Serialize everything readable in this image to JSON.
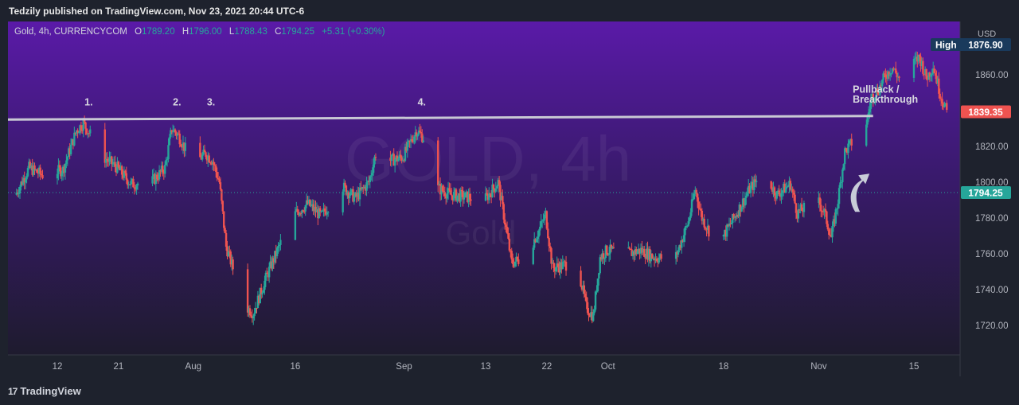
{
  "header": {
    "published": "Tedzily published on TradingView.com, Nov 23, 2021 20:44 UTC-6"
  },
  "footer": {
    "brand": "TradingView",
    "logo_glyph": "17"
  },
  "legend": {
    "symbol": "Gold, 4h, CURRENCYCOM",
    "open_label": "O",
    "open": "1789.20",
    "high_label": "H",
    "high": "1796.00",
    "low_label": "L",
    "low": "1788.43",
    "close_label": "C",
    "close": "1794.25",
    "change": "+5.31 (+0.30%)"
  },
  "watermark": {
    "title": "GOLD, 4h",
    "subtitle": "Gold"
  },
  "colors": {
    "up": "#26a69a",
    "down": "#ef5350",
    "current_price_badge": "#26a69a",
    "breakout_badge": "#ef5350",
    "high_badge": "#1a3a5c",
    "resistance_line": "#c8c8d4",
    "background_top": "#5a1aa8",
    "background_bottom": "#1e1b2e"
  },
  "annotations": [
    {
      "text": "1.",
      "x": "Jul 16",
      "y": 1843
    },
    {
      "text": "2.",
      "x": "Jul 29",
      "y": 1843
    },
    {
      "text": "3.",
      "x": "Aug 3",
      "y": 1843
    },
    {
      "text": "4.",
      "x": "Sep 3",
      "y": 1843
    },
    {
      "text": "Pullback /",
      "x": "Nov 6",
      "y": 1850
    },
    {
      "text": "Breakthrough",
      "x": "Nov 6",
      "y": 1844.5
    }
  ],
  "chart_data": {
    "type": "candlestick",
    "symbol": "Gold",
    "interval": "4h",
    "y_axis_unit": "USD",
    "ylim": [
      1698,
      1895
    ],
    "y_ticks": [
      1720,
      1740,
      1760,
      1780,
      1800,
      1820,
      1840,
      1860
    ],
    "x_ticks": [
      {
        "label": "12",
        "date": "Jul 12"
      },
      {
        "label": "21",
        "date": "Jul 21"
      },
      {
        "label": "Aug",
        "date": "Aug 1"
      },
      {
        "label": "16",
        "date": "Aug 16"
      },
      {
        "label": "Sep",
        "date": "Sep 1"
      },
      {
        "label": "13",
        "date": "Sep 13"
      },
      {
        "label": "22",
        "date": "Sep 22"
      },
      {
        "label": "Oct",
        "date": "Oct 1"
      },
      {
        "label": "18",
        "date": "Oct 18"
      },
      {
        "label": "Nov",
        "date": "Nov 1"
      },
      {
        "label": "15",
        "date": "Nov 15"
      }
    ],
    "price_path": [
      {
        "date": "Jul 6",
        "price": 1793
      },
      {
        "date": "Jul 8",
        "price": 1808
      },
      {
        "date": "Jul 10",
        "price": 1804
      },
      {
        "date": "Jul 13",
        "price": 1807
      },
      {
        "date": "Jul 15",
        "price": 1829
      },
      {
        "date": "Jul 16",
        "price": 1833
      },
      {
        "date": "Jul 19",
        "price": 1814
      },
      {
        "date": "Jul 21",
        "price": 1808
      },
      {
        "date": "Jul 23",
        "price": 1799
      },
      {
        "date": "Jul 26",
        "price": 1800
      },
      {
        "date": "Jul 28",
        "price": 1808
      },
      {
        "date": "Jul 29",
        "price": 1830
      },
      {
        "date": "Jul 30",
        "price": 1826
      },
      {
        "date": "Aug 1",
        "price": 1811
      },
      {
        "date": "Aug 2",
        "price": 1813
      },
      {
        "date": "Aug 3",
        "price": 1816
      },
      {
        "date": "Aug 4",
        "price": 1812
      },
      {
        "date": "Aug 5",
        "price": 1800
      },
      {
        "date": "Aug 6",
        "price": 1764
      },
      {
        "date": "Aug 7",
        "price": 1752
      },
      {
        "date": "Aug 9",
        "price": 1730
      },
      {
        "date": "Aug 10",
        "price": 1727
      },
      {
        "date": "Aug 12",
        "price": 1748
      },
      {
        "date": "Aug 14",
        "price": 1766
      },
      {
        "date": "Aug 16",
        "price": 1782
      },
      {
        "date": "Aug 18",
        "price": 1788
      },
      {
        "date": "Aug 20",
        "price": 1781
      },
      {
        "date": "Aug 23",
        "price": 1798
      },
      {
        "date": "Aug 25",
        "price": 1791
      },
      {
        "date": "Aug 27",
        "price": 1800
      },
      {
        "date": "Aug 28",
        "price": 1816
      },
      {
        "date": "Aug 30",
        "price": 1812
      },
      {
        "date": "Sep 1",
        "price": 1814
      },
      {
        "date": "Sep 3",
        "price": 1829
      },
      {
        "date": "Sep 4",
        "price": 1825
      },
      {
        "date": "Sep 6",
        "price": 1797
      },
      {
        "date": "Sep 8",
        "price": 1793
      },
      {
        "date": "Sep 10",
        "price": 1792
      },
      {
        "date": "Sep 13",
        "price": 1790
      },
      {
        "date": "Sep 15",
        "price": 1800
      },
      {
        "date": "Sep 16",
        "price": 1778
      },
      {
        "date": "Sep 17",
        "price": 1755
      },
      {
        "date": "Sep 19",
        "price": 1758
      },
      {
        "date": "Sep 21",
        "price": 1773
      },
      {
        "date": "Sep 22",
        "price": 1782
      },
      {
        "date": "Sep 23",
        "price": 1752
      },
      {
        "date": "Sep 25",
        "price": 1754
      },
      {
        "date": "Sep 27",
        "price": 1748
      },
      {
        "date": "Sep 28",
        "price": 1730
      },
      {
        "date": "Sep 29",
        "price": 1725
      },
      {
        "date": "Sep 30",
        "price": 1758
      },
      {
        "date": "Oct 1",
        "price": 1762
      },
      {
        "date": "Oct 4",
        "price": 1760
      },
      {
        "date": "Oct 6",
        "price": 1762
      },
      {
        "date": "Oct 8",
        "price": 1758
      },
      {
        "date": "Oct 11",
        "price": 1757
      },
      {
        "date": "Oct 13",
        "price": 1778
      },
      {
        "date": "Oct 14",
        "price": 1796
      },
      {
        "date": "Oct 15",
        "price": 1780
      },
      {
        "date": "Oct 17",
        "price": 1766
      },
      {
        "date": "Oct 18",
        "price": 1769
      },
      {
        "date": "Oct 20",
        "price": 1782
      },
      {
        "date": "Oct 22",
        "price": 1796
      },
      {
        "date": "Oct 24",
        "price": 1805
      },
      {
        "date": "Oct 26",
        "price": 1793
      },
      {
        "date": "Oct 28",
        "price": 1799
      },
      {
        "date": "Oct 29",
        "price": 1783
      },
      {
        "date": "Nov 1",
        "price": 1790
      },
      {
        "date": "Nov 2",
        "price": 1783
      },
      {
        "date": "Nov 3",
        "price": 1769
      },
      {
        "date": "Nov 4",
        "price": 1790
      },
      {
        "date": "Nov 5",
        "price": 1817
      },
      {
        "date": "Nov 6",
        "price": 1822
      },
      {
        "date": "Nov 7",
        "price": 1826
      },
      {
        "date": "Nov 8",
        "price": 1830
      },
      {
        "date": "Nov 9",
        "price": 1848
      },
      {
        "date": "Nov 10",
        "price": 1852
      },
      {
        "date": "Nov 11",
        "price": 1860
      },
      {
        "date": "Nov 12",
        "price": 1864
      },
      {
        "date": "Nov 13",
        "price": 1858
      },
      {
        "date": "Nov 15",
        "price": 1866
      },
      {
        "date": "Nov 16",
        "price": 1870
      },
      {
        "date": "Nov 17",
        "price": 1858
      },
      {
        "date": "Nov 18",
        "price": 1865
      },
      {
        "date": "Nov 19",
        "price": 1850
      },
      {
        "date": "Nov 20",
        "price": 1839
      }
    ],
    "resistance_line": {
      "start": {
        "date": "Jul 6",
        "price": 1835
      },
      "end": {
        "date": "Nov 9",
        "price": 1837
      }
    },
    "current_price": {
      "label": "1794.25",
      "value": 1794.25
    },
    "breakout_price": {
      "label": "1839.35",
      "value": 1839.35
    },
    "high": {
      "label": "High",
      "value_label": "1876.90",
      "value": 1876.9
    },
    "axis_unit_label": "USD"
  }
}
